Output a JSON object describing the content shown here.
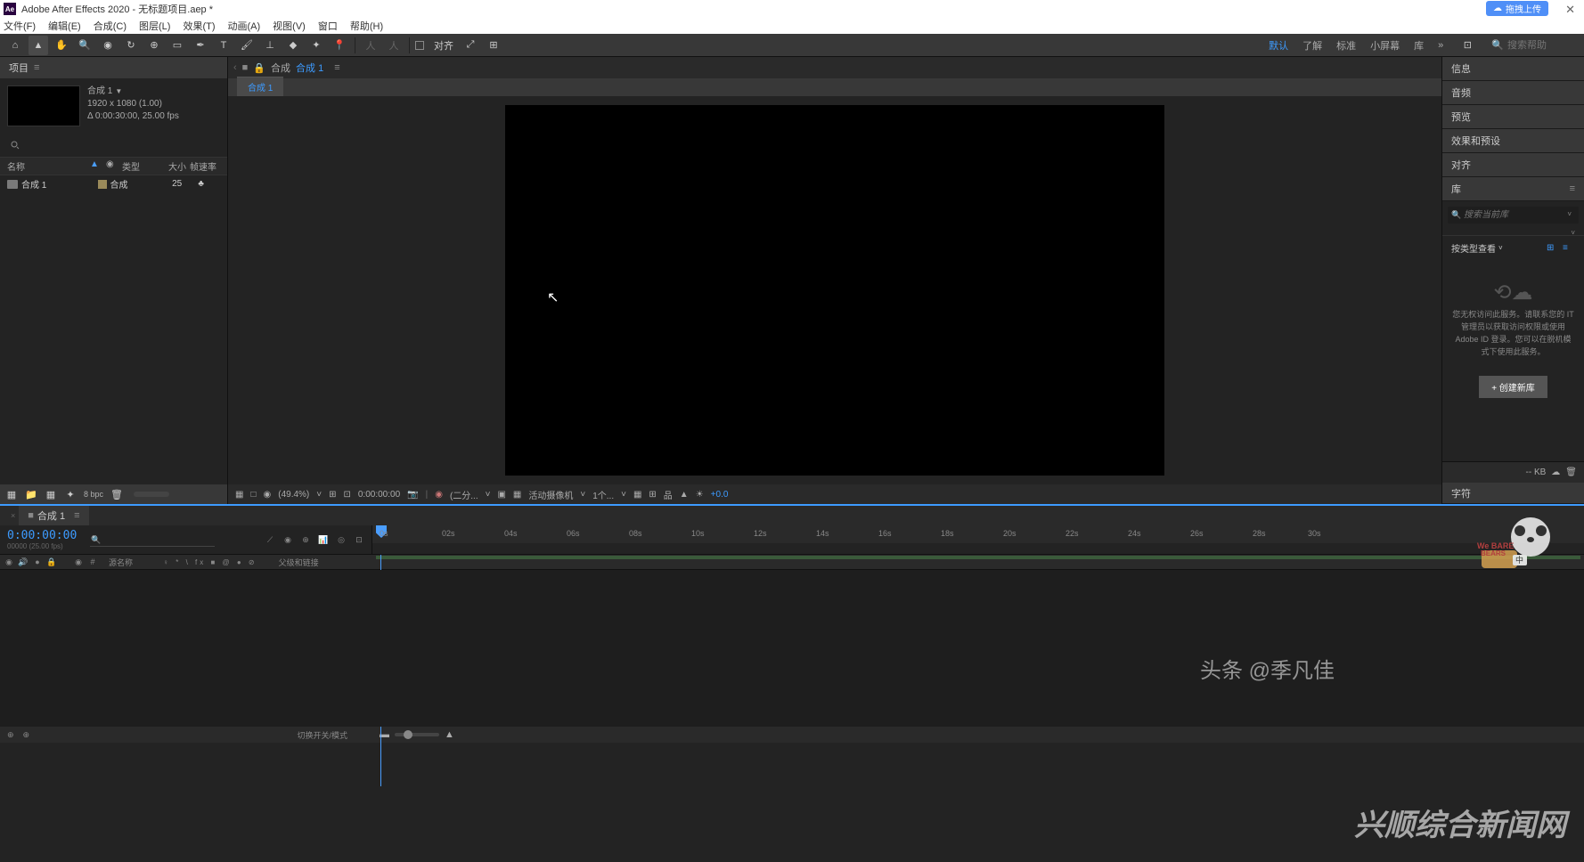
{
  "title": "Adobe After Effects 2020 - 无标题项目.aep *",
  "upload_badge": "拖拽上传",
  "menus": [
    "文件(F)",
    "编辑(E)",
    "合成(C)",
    "图层(L)",
    "效果(T)",
    "动画(A)",
    "视图(V)",
    "窗口",
    "帮助(H)"
  ],
  "toolbar": {
    "align_label": "对齐",
    "search_placeholder": "搜索帮助"
  },
  "workspaces": {
    "default": "默认",
    "learn": "了解",
    "standard": "标准",
    "small": "小屏幕",
    "lib": "库",
    "more": "»"
  },
  "project": {
    "panel_title": "项目",
    "comp_name": "合成 1",
    "resolution": "1920 x 1080 (1.00)",
    "duration_fps": "Δ 0:00:30:00, 25.00 fps",
    "search_placeholder": "",
    "columns": {
      "name": "名称",
      "type": "类型",
      "size": "大小",
      "rate": "帧速率"
    },
    "items": [
      {
        "name": "合成 1",
        "type": "合成",
        "size": "25",
        "rate": ""
      }
    ],
    "bottom_bpc": "8 bpc"
  },
  "viewer": {
    "breadcrumb_prefix": "合成",
    "breadcrumb_active": "合成 1",
    "tab_name": "合成 1",
    "footer": {
      "zoom": "(49.4%)",
      "timecode": "0:00:00:00",
      "resolution": "(二分...",
      "camera": "活动摄像机",
      "views": "1个...",
      "exposure": "+0.0"
    }
  },
  "right_panels": {
    "info": "信息",
    "audio": "音频",
    "preview": "预览",
    "effects": "效果和预设",
    "align": "对齐",
    "library": "库",
    "lib_search_placeholder": "搜索当前库",
    "lib_browse": "按类型查看",
    "lib_message": "您无权访问此服务。请联系您的 IT 管理员以获取访问权限或使用 Adobe ID 登录。您可以在脱机模式下使用此服务。",
    "lib_create": "+ 创建新库",
    "lib_size": "-- KB",
    "char": "字符"
  },
  "timeline": {
    "tab_name": "合成 1",
    "timecode": "0:00:00:00",
    "frames": "00000 (25.00 fps)",
    "search_placeholder": "",
    "col_source": "源名称",
    "col_switches": "♀ * \\ fx ■ @ ● ⊘",
    "col_parent": "父级和链接",
    "toggle_label": "切换开关/模式",
    "ticks": [
      "0s",
      "02s",
      "04s",
      "06s",
      "08s",
      "10s",
      "12s",
      "14s",
      "16s",
      "18s",
      "20s",
      "22s",
      "24s",
      "26s",
      "28s",
      "30s"
    ]
  },
  "watermark": "兴顺综合新闻网",
  "toutiao": "头条 @季凡佳"
}
